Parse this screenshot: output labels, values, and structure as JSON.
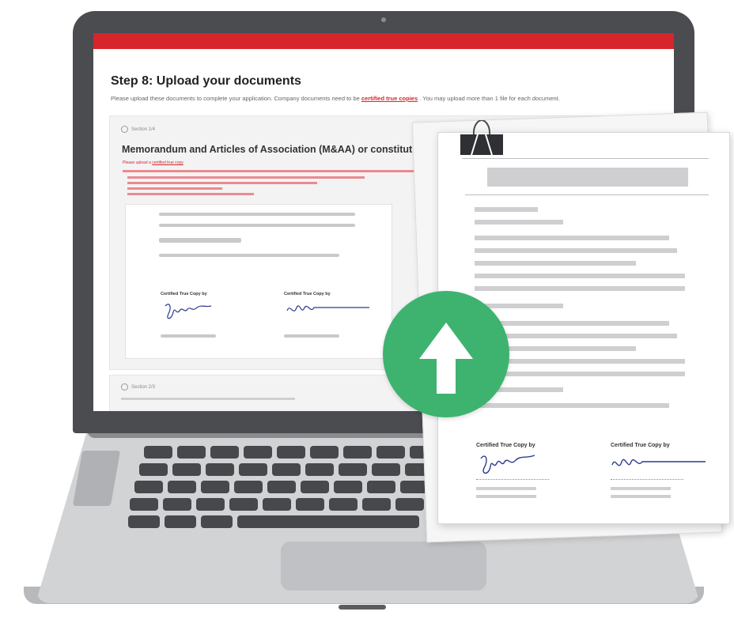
{
  "screen": {
    "step_title": "Step 8: Upload your documents",
    "step_desc_before": "Please upload these documents to complete your application. Company documents need to be",
    "step_desc_link": "certified true copies",
    "step_desc_after": ". You may upload more than 1 file for each document.",
    "section1": {
      "radio_label": "Section 1/4",
      "title": "Memorandum and Articles of Association (M&AA) or constitution",
      "sub_prefix": "Please upload a",
      "sub_link": "certified true copy"
    },
    "section2": {
      "radio_label": "Section 2/3"
    },
    "inner_doc": {
      "ctc_left": "Certified True Copy by",
      "ctc_right": "Certified True Copy by"
    }
  },
  "paper": {
    "ctc_left": "Certified True Copy by",
    "ctc_right": "Certified True Copy by"
  },
  "icons": {
    "upload": "upload-arrow-icon",
    "clip": "binder-clip-icon",
    "signature": "signature-icon"
  },
  "colors": {
    "accent_red": "#d6262c",
    "upload_green": "#3db36f",
    "bezel": "#4b4c50"
  }
}
